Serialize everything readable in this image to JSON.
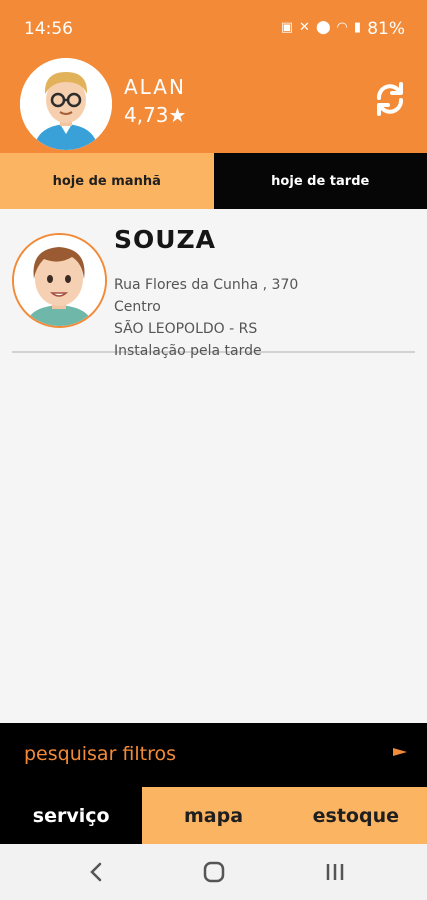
{
  "status_bar": {
    "time": "14:56",
    "battery": "81%",
    "icons": [
      "notification-icon",
      "mute-icon",
      "location-icon",
      "wifi-icon",
      "volte-icon",
      "signal-icon",
      "battery-icon"
    ]
  },
  "header": {
    "user_name": "ALAN",
    "rating": "4,73★",
    "colors": {
      "accent": "#f28a38"
    }
  },
  "day_tabs": [
    {
      "label": "hoje de manhã",
      "active": true
    },
    {
      "label": "hoje de tarde",
      "active": false
    }
  ],
  "service_list": [
    {
      "name": "SOUZA",
      "address": "Rua Flores da Cunha , 370",
      "district": "Centro",
      "city": "SÃO LEOPOLDO - RS",
      "note": "Instalação pela tarde"
    }
  ],
  "filter": {
    "label": "pesquisar filtros"
  },
  "bottom_tabs": [
    {
      "label": "serviço",
      "active": true
    },
    {
      "label": "mapa",
      "active": false
    },
    {
      "label": "estoque",
      "active": false
    }
  ],
  "system_nav": [
    "back-icon",
    "home-icon",
    "recents-icon"
  ]
}
